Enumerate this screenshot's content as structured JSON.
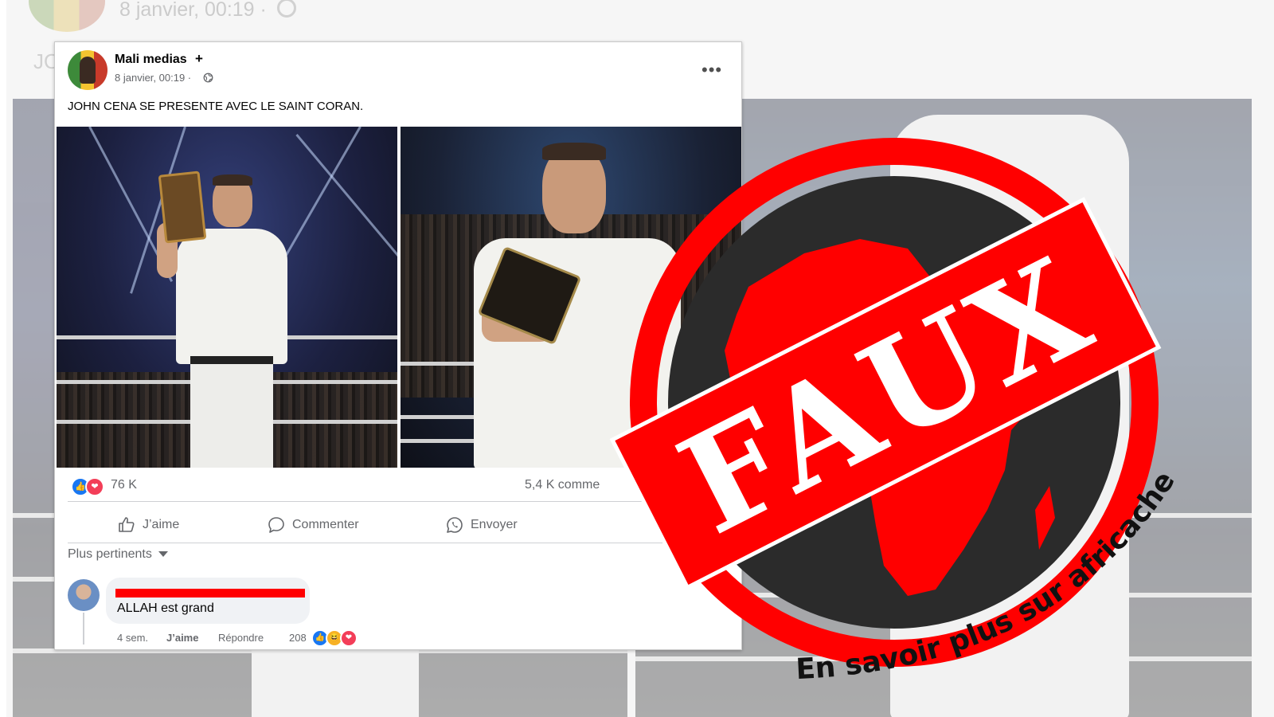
{
  "background": {
    "date": "8 janvier, 00:19 ·",
    "text": "JO"
  },
  "post": {
    "page_name": "Mali medias",
    "follow_label": "+",
    "date": "8 janvier, 00:19 ·",
    "text": "JOHN CENA SE PRESENTE AVEC LE SAINT CORAN.",
    "reaction_count": "76 K",
    "comment_count": "5,4 K comme",
    "actions": {
      "like": "J’aime",
      "comment": "Commenter",
      "send": "Envoyer"
    },
    "sort_label": "Plus pertinents"
  },
  "comment": {
    "text": "ALLAH est grand",
    "age": "4 sem.",
    "like": "J’aime",
    "reply": "Répondre",
    "reactions": "208"
  },
  "stamp": {
    "label": "FAUX",
    "footer": "En savoir plus sur africacheck.org/fr",
    "colors": {
      "red": "#ff0000",
      "dark": "#2b2b2b",
      "white": "#ffffff"
    }
  },
  "icons": [
    "globe-icon",
    "more-icon",
    "like-icon",
    "comment-icon",
    "whatsapp-icon",
    "chevron-down-icon",
    "love-icon",
    "haha-icon",
    "africa-map-icon"
  ]
}
